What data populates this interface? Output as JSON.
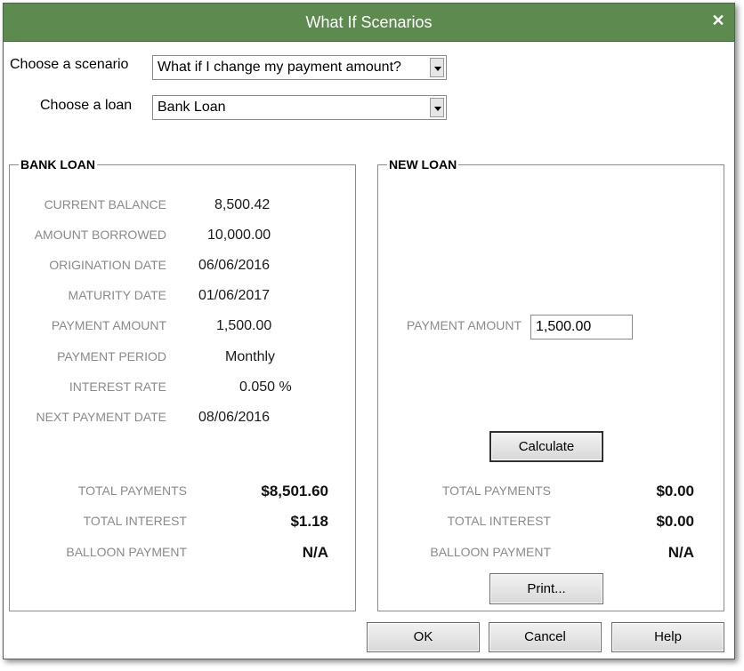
{
  "window": {
    "title": "What If Scenarios",
    "close_glyph": "✕"
  },
  "scenario": {
    "label": "Choose a scenario",
    "value": "What if I change my payment amount?"
  },
  "loan": {
    "label": "Choose a loan",
    "value": "Bank Loan"
  },
  "current_loan": {
    "heading": "BANK LOAN",
    "fields": [
      {
        "label": "CURRENT BALANCE",
        "value": "8,500.42"
      },
      {
        "label": "AMOUNT BORROWED",
        "value": "10,000.00"
      },
      {
        "label": "ORIGINATION DATE",
        "value": "06/06/2016"
      },
      {
        "label": "MATURITY DATE",
        "value": "01/06/2017"
      },
      {
        "label": "PAYMENT AMOUNT",
        "value": "1,500.00"
      },
      {
        "label": "PAYMENT PERIOD",
        "value": "Monthly"
      },
      {
        "label": "INTEREST RATE",
        "value": "0.050 %"
      },
      {
        "label": "NEXT PAYMENT DATE",
        "value": "08/06/2016"
      }
    ],
    "totals": [
      {
        "label": "TOTAL PAYMENTS",
        "value": "$8,501.60"
      },
      {
        "label": "TOTAL INTEREST",
        "value": "$1.18"
      },
      {
        "label": "BALLOON PAYMENT",
        "value": "N/A"
      }
    ]
  },
  "new_loan": {
    "heading": "NEW LOAN",
    "payment_amount_label": "PAYMENT AMOUNT",
    "payment_amount_value": "1,500.00",
    "calculate_label": "Calculate",
    "print_label": "Print...",
    "totals": [
      {
        "label": "TOTAL PAYMENTS",
        "value": "$0.00"
      },
      {
        "label": "TOTAL INTEREST",
        "value": "$0.00"
      },
      {
        "label": "BALLOON PAYMENT",
        "value": "N/A"
      }
    ]
  },
  "buttons": {
    "ok": "OK",
    "cancel": "Cancel",
    "help": "Help"
  },
  "colors": {
    "titlebar": "#5d8a4e",
    "label_gray": "#8a8a8a"
  }
}
